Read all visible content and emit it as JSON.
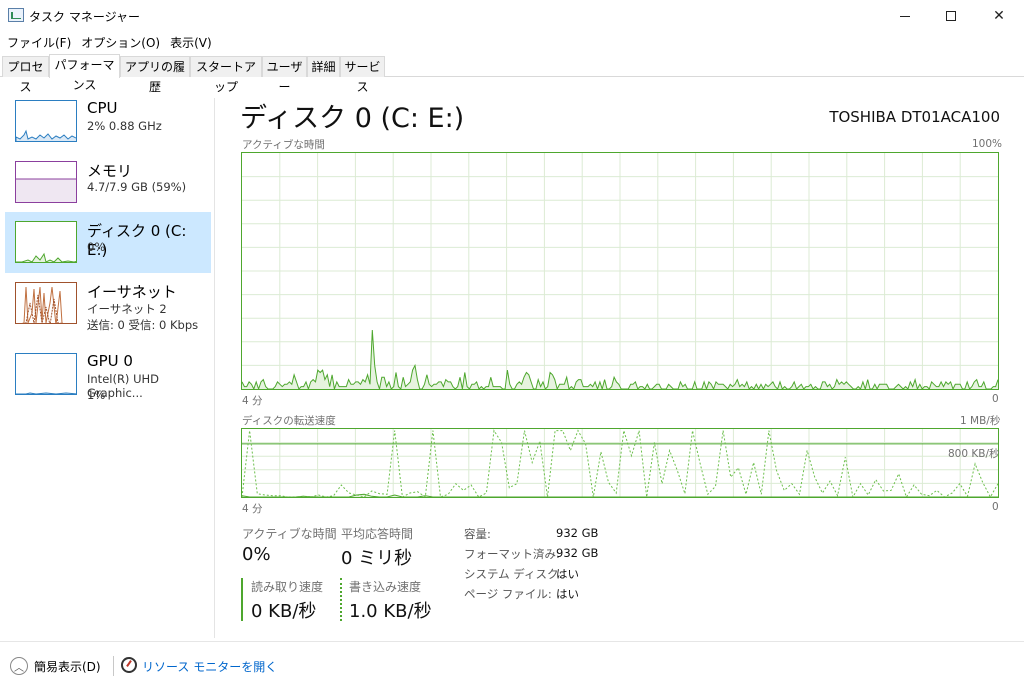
{
  "window": {
    "title": "タスク マネージャー",
    "minimize": "—",
    "maximize": "□",
    "close": "✕"
  },
  "menu": [
    "ファイル(F)",
    "オプション(O)",
    "表示(V)"
  ],
  "tabs": [
    "プロセス",
    "パフォーマンス",
    "アプリの履歴",
    "スタートアップ",
    "ユーザー",
    "詳細",
    "サービス"
  ],
  "active_tab": "パフォーマンス",
  "sidebar": {
    "items": [
      {
        "title": "CPU",
        "sub1": "2% 0.88 GHz",
        "sub2": "",
        "color": "#2b7ec1"
      },
      {
        "title": "メモリ",
        "sub1": "4.7/7.9 GB (59%)",
        "sub2": "",
        "color": "#8b3f9e"
      },
      {
        "title": "ディスク 0 (C: E:)",
        "sub1": "0%",
        "sub2": "",
        "color": "#4ea72e",
        "selected": true
      },
      {
        "title": "イーサネット",
        "sub1": "イーサネット 2",
        "sub2": "送信: 0  受信: 0 Kbps",
        "color": "#a0522d"
      },
      {
        "title": "GPU 0",
        "sub1": "Intel(R) UHD Graphic...",
        "sub2": "1%",
        "color": "#2b7ec1"
      }
    ]
  },
  "main": {
    "title": "ディスク 0 (C: E:)",
    "model": "TOSHIBA DT01ACA100",
    "graph1": {
      "label": "アクティブな時間",
      "max_label": "100%",
      "time_label": "4 分",
      "min_label": "0",
      "values_percent": [
        3,
        1,
        1,
        3,
        2,
        0,
        3,
        0,
        3,
        4,
        1,
        0,
        0,
        0,
        1,
        3,
        2,
        1,
        2,
        2,
        3,
        2,
        6,
        3,
        0,
        1,
        1,
        3,
        0,
        3,
        4,
        3,
        8,
        7,
        8,
        4,
        6,
        1,
        6,
        0,
        3,
        1,
        1,
        1,
        1,
        4,
        2,
        2,
        3,
        3,
        2,
        4,
        3,
        6,
        2,
        25,
        10,
        3,
        0,
        5,
        5,
        1,
        3,
        0,
        1,
        7,
        1,
        0,
        5,
        1,
        2,
        3,
        8,
        10,
        4,
        0,
        0,
        2,
        6,
        2,
        1,
        2,
        2,
        3,
        3,
        1,
        4,
        3,
        3,
        1,
        0,
        1,
        5,
        0,
        7,
        1,
        0,
        2,
        2,
        3,
        0,
        1,
        0,
        1,
        1,
        5,
        1,
        1,
        1,
        1,
        0,
        0,
        8,
        2,
        0,
        0,
        2,
        3,
        2,
        5,
        7,
        6,
        3,
        0,
        0,
        4,
        1,
        3,
        0,
        1,
        7,
        6,
        4,
        0,
        2,
        2,
        2,
        5,
        0,
        1,
        0,
        3,
        4,
        4,
        1,
        1,
        1,
        2,
        1,
        3,
        0,
        3,
        0,
        4,
        0,
        0,
        1,
        5,
        3,
        2,
        0,
        0,
        0,
        0,
        2,
        2,
        3,
        0,
        1,
        1,
        0,
        2,
        0,
        0,
        1,
        2,
        2,
        0,
        0,
        0,
        2,
        1,
        0,
        0,
        0,
        3,
        1,
        2,
        0,
        0,
        0,
        3,
        0,
        0,
        0,
        3,
        0,
        3,
        2,
        0,
        3,
        2,
        2,
        2,
        1,
        0,
        2,
        1,
        2,
        4,
        1,
        2,
        1,
        3,
        0,
        1,
        0,
        2,
        0,
        2,
        0,
        2,
        1,
        2,
        3,
        1,
        0,
        3,
        0,
        1,
        0,
        0,
        1,
        3,
        0,
        1,
        2,
        0,
        1,
        1,
        2,
        0,
        1,
        0,
        0,
        3,
        3,
        1,
        2,
        0,
        1,
        4,
        2,
        3,
        2,
        3,
        2,
        1,
        0,
        0,
        1,
        0,
        3,
        0,
        4,
        0,
        0,
        2,
        0,
        2,
        2,
        2,
        2,
        0,
        0,
        0,
        1,
        2,
        1,
        0,
        1,
        0,
        3,
        1,
        4,
        0,
        2,
        0,
        1,
        1,
        0,
        3,
        2,
        1,
        1,
        3,
        1,
        3,
        2,
        3,
        0,
        2,
        2,
        2,
        0,
        0,
        3,
        0,
        1,
        3,
        4,
        1,
        1,
        3,
        0,
        0,
        0,
        1,
        1,
        4
      ]
    },
    "graph2": {
      "label": "ディスクの転送速度",
      "max_label": "1 MB/秒",
      "ref_label": "800 KB/秒",
      "time_label": "4 分",
      "min_label": "0",
      "read_kbps": [
        20,
        0,
        0,
        0,
        0,
        0,
        0,
        0,
        10,
        5,
        0,
        0,
        0,
        0,
        0,
        30,
        40,
        10,
        0,
        0,
        30,
        0,
        0,
        0,
        20,
        0,
        0,
        0,
        0,
        0,
        0,
        0,
        0,
        0,
        0,
        0,
        0,
        0,
        0,
        0,
        0,
        0,
        0,
        0,
        0,
        0,
        0,
        0,
        0,
        0,
        0,
        0,
        0,
        0,
        0,
        0,
        0,
        0,
        0,
        0,
        0,
        0,
        0,
        0,
        0,
        0,
        0,
        0,
        0,
        0,
        0,
        0,
        0,
        0,
        0,
        0,
        0,
        0,
        0,
        0,
        0,
        0,
        0,
        0,
        0,
        0,
        0,
        0,
        0,
        0,
        0,
        0,
        0,
        0,
        0,
        0,
        0,
        0,
        0,
        0
      ],
      "write_kbps": [
        0,
        1000,
        50,
        30,
        20,
        20,
        0,
        0,
        10,
        0,
        30,
        0,
        20,
        180,
        60,
        30,
        0,
        90,
        50,
        40,
        1000,
        0,
        60,
        80,
        0,
        1000,
        0,
        40,
        200,
        100,
        180,
        0,
        60,
        1000,
        820,
        140,
        200,
        1000,
        520,
        840,
        0,
        1000,
        1000,
        700,
        1000,
        800,
        0,
        680,
        220,
        60,
        1000,
        620,
        1000,
        0,
        820,
        200,
        700,
        400,
        50,
        1000,
        500,
        40,
        160,
        1000,
        300,
        440,
        40,
        520,
        40,
        1000,
        400,
        100,
        200,
        40,
        700,
        300,
        60,
        240,
        20,
        600,
        0,
        200,
        30,
        260,
        90,
        100,
        350,
        0,
        180,
        40,
        20,
        100,
        0,
        60,
        200,
        10,
        500,
        220,
        0,
        200
      ]
    },
    "stats": {
      "active_label": "アクティブな時間",
      "active_value": "0%",
      "response_label": "平均応答時間",
      "response_value": "0 ミリ秒",
      "read_label": "読み取り速度",
      "read_value": "0 KB/秒",
      "write_label": "書き込み速度",
      "write_value": "1.0 KB/秒"
    },
    "info": [
      {
        "key": "容量:",
        "value": "932 GB"
      },
      {
        "key": "フォーマット済み:",
        "value": "932 GB"
      },
      {
        "key": "システム ディスク:",
        "value": "はい"
      },
      {
        "key": "ページ ファイル:",
        "value": "はい"
      }
    ]
  },
  "footer": {
    "fewer_details": "簡易表示(D)",
    "resource_monitor": "リソース モニターを開く"
  }
}
